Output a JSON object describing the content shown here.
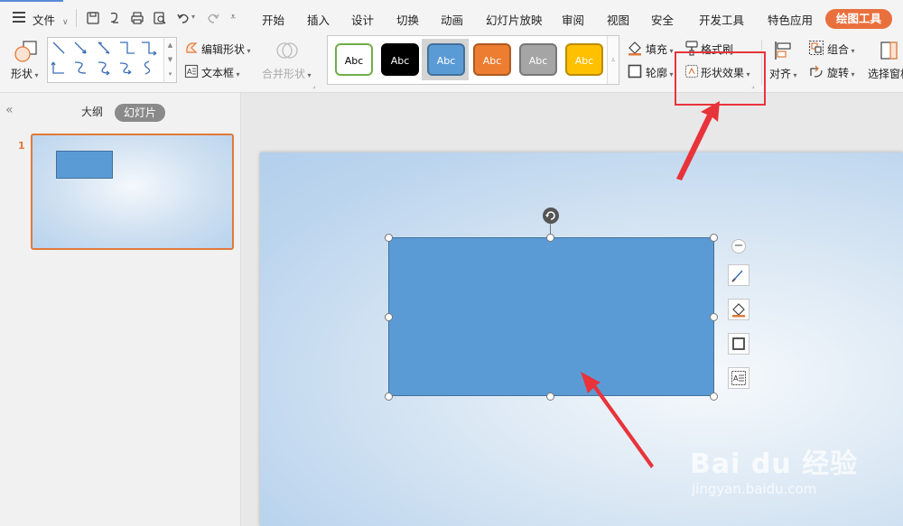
{
  "menubar": {
    "file_label": "文件",
    "tabs": [
      "开始",
      "插入",
      "设计",
      "切换",
      "动画",
      "幻灯片放映",
      "审阅",
      "视图",
      "安全",
      "开发工具",
      "特色应用"
    ],
    "active_tab": "绘图工具"
  },
  "ribbon": {
    "shape_label": "形状",
    "edit_shape_label": "编辑形状",
    "textbox_label": "文本框",
    "merge_shape_label": "合并形状",
    "fill_label": "填充",
    "format_brush_label": "格式刷",
    "outline_label": "轮廓",
    "shape_effect_label": "形状效果",
    "align_label": "对齐",
    "group_label": "组合",
    "rotate_label": "旋转",
    "select_pane_label": "选择窗格",
    "style_presets": [
      {
        "label": "Abc",
        "fill": "#ffffff",
        "border": "#70ad47",
        "text": "#000000"
      },
      {
        "label": "Abc",
        "fill": "#000000",
        "border": "#000000",
        "text": "#ffffff"
      },
      {
        "label": "Abc",
        "fill": "#5b9bd5",
        "border": "#41719c",
        "text": "#ffffff"
      },
      {
        "label": "Abc",
        "fill": "#ed7d31",
        "border": "#ae5a21",
        "text": "#ffffff"
      },
      {
        "label": "Abc",
        "fill": "#a5a5a5",
        "border": "#787878",
        "text": "#ffffff"
      },
      {
        "label": "Abc",
        "fill": "#ffc000",
        "border": "#bc8c00",
        "text": "#ffffff"
      }
    ]
  },
  "leftpanel": {
    "outline_tab": "大纲",
    "slides_tab": "幻灯片",
    "slide_number": "1",
    "collapse_icon": "«"
  },
  "canvas": {
    "shape_fill": "#5b9bd5",
    "shape_border": "#41719c"
  },
  "annotation": {
    "highlight_color": "#e8333a"
  },
  "watermark": {
    "brand": "Bai du 经验",
    "url": "jingyan.baidu.com"
  }
}
